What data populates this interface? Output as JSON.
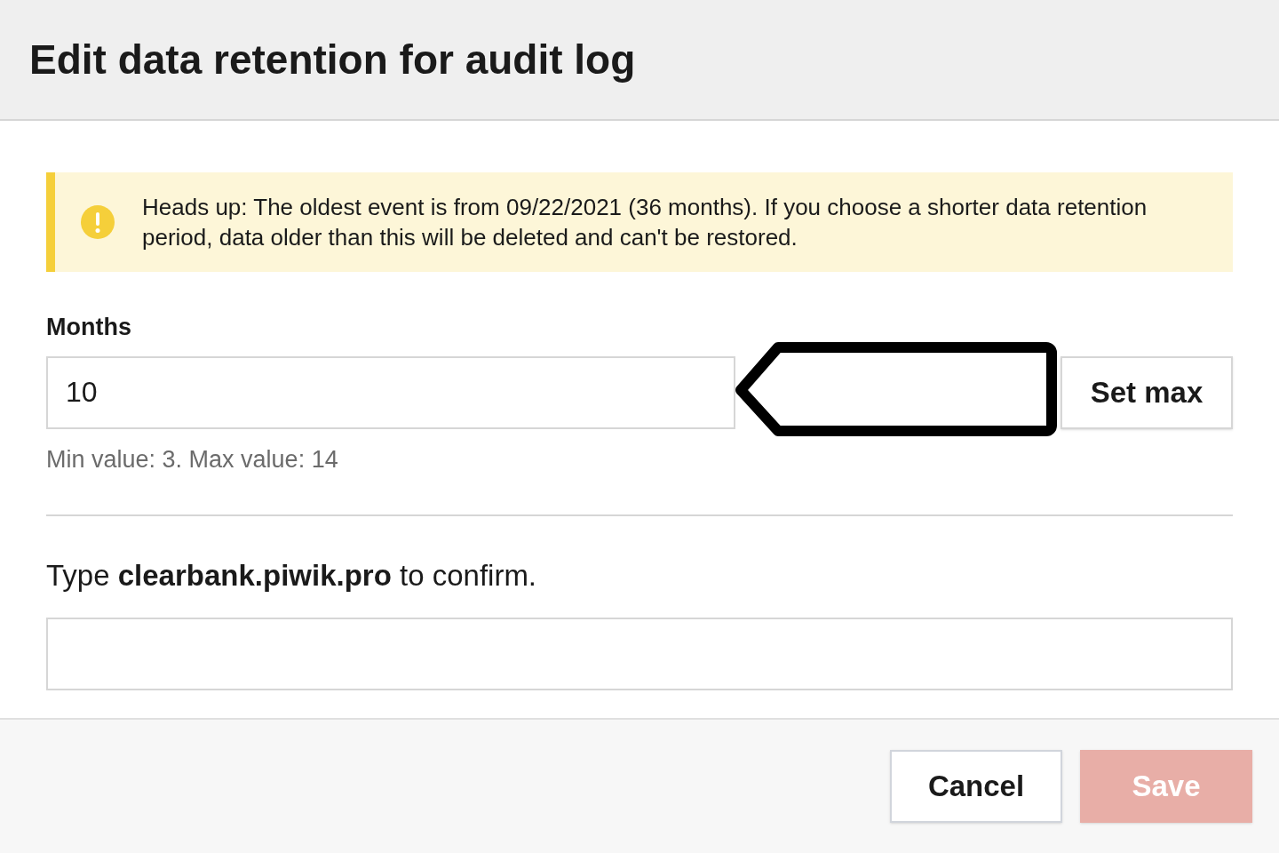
{
  "dialog": {
    "title": "Edit data retention for audit log"
  },
  "alert": {
    "message": "Heads up: The oldest event is from 09/22/2021 (36 months). If you choose a shorter data retention period, data older than this will be deleted and can't be restored."
  },
  "months_field": {
    "label": "Months",
    "value": "10",
    "set_max_button": "Set max",
    "help": "Min value: 3. Max value: 14"
  },
  "confirm_field": {
    "prompt": "Type **clearbank.piwik.pro** to confirm."
  },
  "buttons": [
    {
      "kind": "secondary",
      "label": "Cancel",
      "disabled": false
    },
    {
      "kind": "primary",
      "label": "Save",
      "disabled": true
    }
  ]
}
